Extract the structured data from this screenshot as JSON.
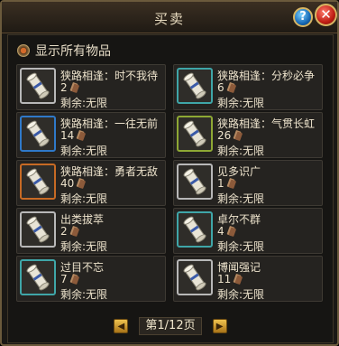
{
  "window": {
    "title": "买卖"
  },
  "filter": {
    "label": "显示所有物品"
  },
  "items": [
    {
      "name": "狭路相逢：时不我待",
      "qty": "2",
      "remain": "剩余:无限",
      "border": "white"
    },
    {
      "name": "狭路相逢：分秒必争",
      "qty": "6",
      "remain": "剩余:无限",
      "border": "teal"
    },
    {
      "name": "狭路相逢：一往无前",
      "qty": "14",
      "remain": "剩余:无限",
      "border": "blue"
    },
    {
      "name": "狭路相逢：气贯长虹",
      "qty": "26",
      "remain": "剩余:无限",
      "border": "green"
    },
    {
      "name": "狭路相逢：勇者无敌",
      "qty": "40",
      "remain": "剩余:无限",
      "border": "orange"
    },
    {
      "name": "见多识广",
      "qty": "1",
      "remain": "剩余:无限",
      "border": "white"
    },
    {
      "name": "出类拔萃",
      "qty": "2",
      "remain": "剩余:无限",
      "border": "white"
    },
    {
      "name": "卓尔不群",
      "qty": "4",
      "remain": "剩余:无限",
      "border": "teal"
    },
    {
      "name": "过目不忘",
      "qty": "7",
      "remain": "剩余:无限",
      "border": "teal"
    },
    {
      "name": "博闻强记",
      "qty": "11",
      "remain": "剩余:无限",
      "border": "white"
    }
  ],
  "pager": {
    "label": "第1/12页",
    "prev_icon": "arrow-left-icon",
    "next_icon": "arrow-right-icon"
  },
  "buttons": {
    "help": "?",
    "close": "✕"
  }
}
